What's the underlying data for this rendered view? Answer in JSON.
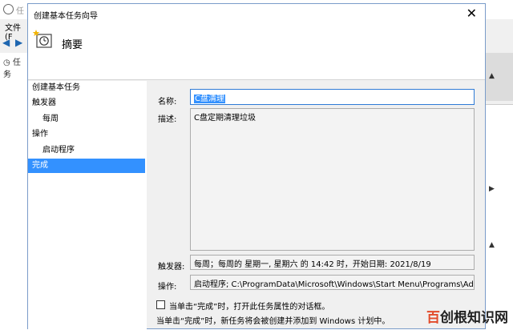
{
  "background": {
    "title_fragment": "任",
    "menu_file": "文件(F",
    "tree_item": "任务"
  },
  "dialog": {
    "title": "创建基本任务向导",
    "close": "✕",
    "header_title": "摘要"
  },
  "steps": [
    {
      "label": "创建基本任务"
    },
    {
      "label": "触发器"
    },
    {
      "label": "每周"
    },
    {
      "label": "操作"
    },
    {
      "label": "启动程序"
    },
    {
      "label": "完成"
    }
  ],
  "form": {
    "name_label": "名称:",
    "name_value": "C盘清理",
    "desc_label": "描述:",
    "desc_value": "C盘定期清理垃圾",
    "trigger_label": "触发器:",
    "trigger_value": "每周；每周的 星期一, 星期六 的 14:42 时，开始日期: 2021/8/19",
    "action_label": "操作:",
    "action_value": "启动程序; C:\\ProgramData\\Microsoft\\Windows\\Start Menu\\Programs\\Adn",
    "checkbox_label": "当单击“完成”时，打开此任务属性的对话框。",
    "note": "当单击“完成”时，新任务将会被创建并添加到 Windows 计划中。"
  },
  "watermark": {
    "part1": "百",
    "part2": "创根知识网"
  },
  "icons": {
    "wizard": "wizard-clock-icon",
    "back": "back-arrow-icon",
    "forward": "forward-arrow-icon"
  }
}
